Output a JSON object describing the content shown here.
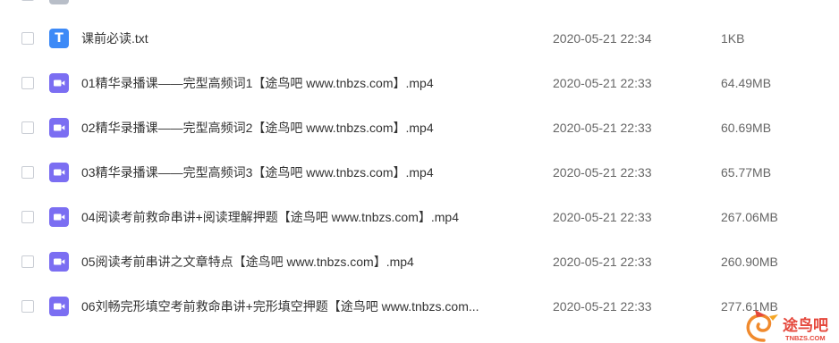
{
  "colors": {
    "txt_icon": "#3d8af7",
    "video_icon": "#7b6ef2",
    "cut_off_icon": "#b8bec8",
    "watermark_text": "#e5473b"
  },
  "partial_row_above": {
    "icon": "file-icon"
  },
  "file_list": {
    "rows": [
      {
        "type": "txt",
        "icon": "txt-file-icon",
        "icon_glyph": "T",
        "name": "课前必读.txt",
        "modified": "2020-05-21 22:34",
        "size": "1KB"
      },
      {
        "type": "video",
        "icon": "video-file-icon",
        "name": "01精华录播课——完型高频词1【途鸟吧 www.tnbzs.com】.mp4",
        "modified": "2020-05-21 22:33",
        "size": "64.49MB"
      },
      {
        "type": "video",
        "icon": "video-file-icon",
        "name": "02精华录播课——完型高频词2【途鸟吧 www.tnbzs.com】.mp4",
        "modified": "2020-05-21 22:33",
        "size": "60.69MB"
      },
      {
        "type": "video",
        "icon": "video-file-icon",
        "name": "03精华录播课——完型高频词3【途鸟吧 www.tnbzs.com】.mp4",
        "modified": "2020-05-21 22:33",
        "size": "65.77MB"
      },
      {
        "type": "video",
        "icon": "video-file-icon",
        "name": "04阅读考前救命串讲+阅读理解押题【途鸟吧 www.tnbzs.com】.mp4",
        "modified": "2020-05-21 22:33",
        "size": "267.06MB"
      },
      {
        "type": "video",
        "icon": "video-file-icon",
        "name": "05阅读考前串讲之文章特点【途鸟吧 www.tnbzs.com】.mp4",
        "modified": "2020-05-21 22:33",
        "size": "260.90MB"
      },
      {
        "type": "video",
        "icon": "video-file-icon",
        "name": "06刘畅完形填空考前救命串讲+完形填空押题【途鸟吧 www.tnbzs.com...",
        "modified": "2020-05-21 22:33",
        "size": "277.61MB"
      }
    ]
  },
  "watermark": {
    "brand": "途鸟吧",
    "domain": "TNBZS.COM"
  }
}
